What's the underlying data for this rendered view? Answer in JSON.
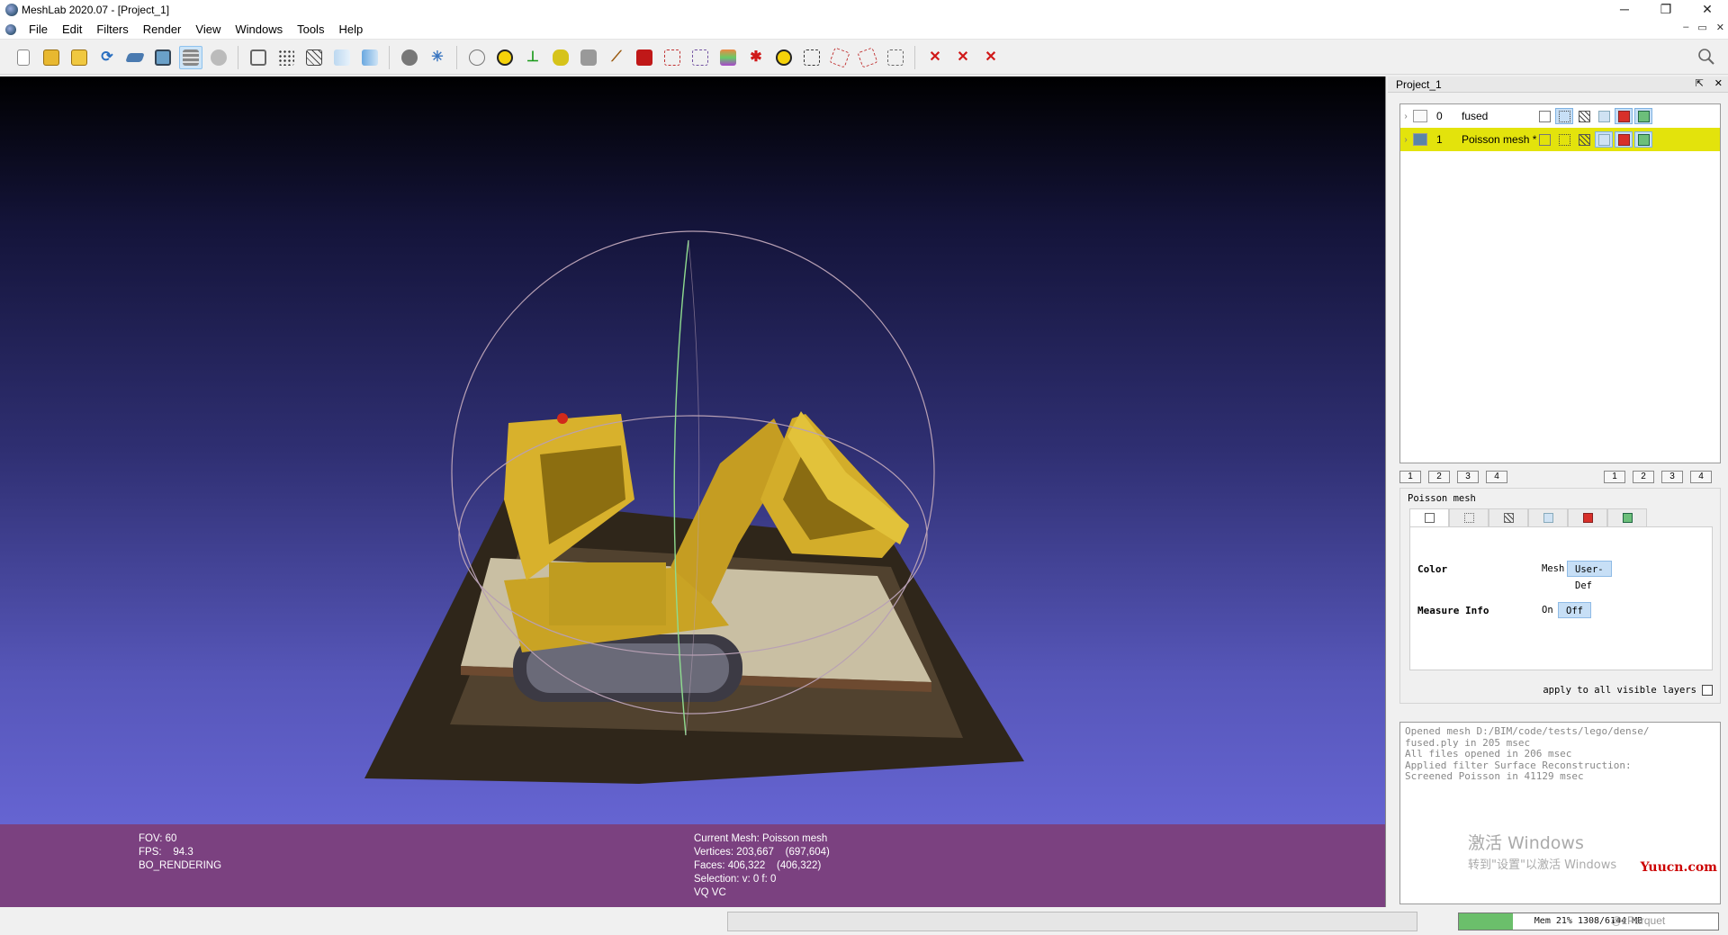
{
  "window": {
    "title": "MeshLab 2020.07 - [Project_1]",
    "controls": [
      "─",
      "❐",
      "✕"
    ]
  },
  "menu": {
    "items": [
      "File",
      "Edit",
      "Filters",
      "Render",
      "View",
      "Windows",
      "Tools",
      "Help"
    ],
    "mdi_controls": [
      "–",
      "▭",
      "✕"
    ]
  },
  "toolbar": {
    "groups": [
      [
        "new-project",
        "open-project",
        "save-project",
        "reload",
        "import-mesh",
        "snapshot",
        "layers",
        "raster"
      ],
      [
        "bounding-box",
        "points",
        "wireframe",
        "flat",
        "smooth"
      ],
      [
        "render-mode",
        "light"
      ],
      [
        "trackball",
        "annotate",
        "axis",
        "paint-bucket",
        "camera",
        "brush",
        "p-tool",
        "select-vertex",
        "select-face",
        "georef-color",
        "georef",
        "info",
        "select-rect",
        "select-connected",
        "select-paint",
        "align"
      ],
      [
        "delete-face",
        "delete-vertex",
        "delete-all"
      ]
    ]
  },
  "viewport": {
    "info_left": [
      "FOV: 60",
      "FPS:    94.3",
      "BO_RENDERING"
    ],
    "info_right": [
      "Current Mesh: Poisson mesh",
      "Vertices: 203,667    (697,604)",
      "Faces: 406,322    (406,322)",
      "Selection: v: 0 f: 0",
      "VQ VC"
    ]
  },
  "panel": {
    "title": "Project_1",
    "controls": [
      "⇱",
      "✕"
    ],
    "layers": [
      {
        "id": "0",
        "name": "fused",
        "visible": false,
        "selected": false
      },
      {
        "id": "1",
        "name": "Poisson mesh *",
        "visible": true,
        "selected": true
      }
    ],
    "page_buttons_left": [
      "1",
      "2",
      "3",
      "4"
    ],
    "page_buttons_right": [
      "1",
      "2",
      "3",
      "4"
    ],
    "decorator_title": "Poisson mesh",
    "color_label": "Color",
    "color_options": [
      "Mesh",
      "User-Def"
    ],
    "measure_label": "Measure Info",
    "measure_options": [
      "On",
      "Off"
    ],
    "apply_label": "apply to all visible layers"
  },
  "log": {
    "lines": [
      "Opened mesh D:/BIM/code/tests/lego/dense/",
      "fused.ply in 205 msec",
      "All files opened in 206 msec",
      "Applied filter Surface Reconstruction:",
      "Screened Poisson in 41129 msec"
    ],
    "watermark_1": "激活 Windows",
    "watermark_2": "转到\"设置\"以激活 Windows",
    "watermark_3": "Yuucn.com"
  },
  "status": {
    "memory_text": "Mem 21% 1308/6144 MB",
    "memory_fraction": 0.21,
    "watermark": "@zParquet"
  }
}
